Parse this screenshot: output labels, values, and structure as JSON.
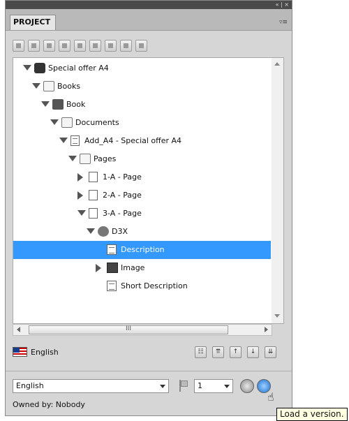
{
  "panel": {
    "tab_label": "PROJECT",
    "title_controls": "« | ×",
    "menu_glyph": "▿≡"
  },
  "toolbar": {
    "icons": [
      "layout-icon",
      "save-icon",
      "edit-icon",
      "add-icon",
      "copy-icon",
      "delete-icon",
      "new-page-icon",
      "preview-icon",
      "settings-icon"
    ]
  },
  "tree": {
    "rows": [
      {
        "label": "Special offer A4",
        "indent": 0,
        "expander": "open",
        "icon": "books",
        "selected": false
      },
      {
        "label": "Books",
        "indent": 1,
        "expander": "open",
        "icon": "folder",
        "selected": false
      },
      {
        "label": "Book",
        "indent": 2,
        "expander": "open",
        "icon": "book",
        "selected": false
      },
      {
        "label": "Documents",
        "indent": 3,
        "expander": "open",
        "icon": "folder",
        "selected": false
      },
      {
        "label": "Add_A4 - Special offer A4",
        "indent": 4,
        "expander": "open",
        "icon": "doc",
        "selected": false
      },
      {
        "label": "Pages",
        "indent": 5,
        "expander": "open",
        "icon": "folder",
        "selected": false
      },
      {
        "label": "1-A - Page",
        "indent": 6,
        "expander": "closed",
        "icon": "page",
        "selected": false
      },
      {
        "label": "2-A - Page",
        "indent": 6,
        "expander": "closed",
        "icon": "page",
        "selected": false
      },
      {
        "label": "3-A - Page",
        "indent": 6,
        "expander": "open",
        "icon": "page",
        "selected": false
      },
      {
        "label": "D3X",
        "indent": 7,
        "expander": "open",
        "icon": "d3x",
        "selected": false
      },
      {
        "label": "Description",
        "indent": 8,
        "expander": "none",
        "icon": "text",
        "selected": true
      },
      {
        "label": "Image",
        "indent": 8,
        "expander": "closed",
        "icon": "image",
        "selected": false
      },
      {
        "label": "Short Description",
        "indent": 8,
        "expander": "none",
        "icon": "text",
        "selected": false
      }
    ]
  },
  "hscroll": {
    "thumb_grip": "III"
  },
  "language": {
    "label": "English"
  },
  "nav_buttons": [
    "outline-icon",
    "move-top-icon",
    "move-up-icon",
    "move-down-icon",
    "move-bottom-icon"
  ],
  "bottom": {
    "language_select": "English",
    "version_select": "1",
    "owned_by": "Owned by: Nobody"
  },
  "tooltip": {
    "text": "Load a version."
  },
  "colors": {
    "selection": "#3399ff",
    "panel_bg": "#d6d6d6",
    "tooltip_bg": "#ffffe1"
  }
}
